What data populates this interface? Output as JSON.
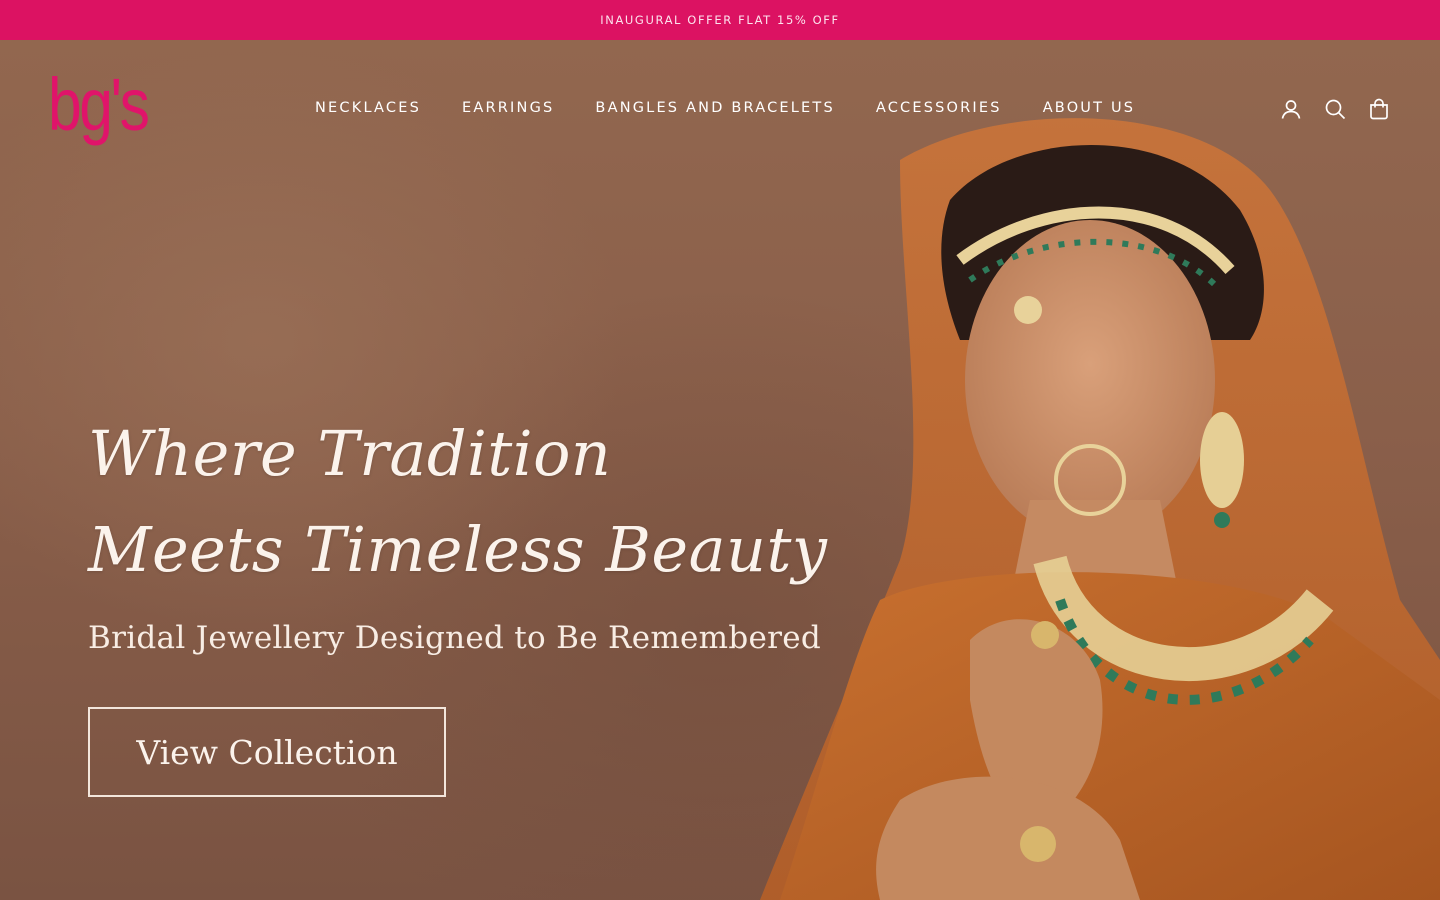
{
  "colors": {
    "announcement_bg": "#dc1262",
    "brand_pink": "#e0146a",
    "nav_text": "#ffffff",
    "hero_bg": "#8a5e48"
  },
  "announcement": {
    "text": "INAUGURAL OFFER FLAT 15% OFF"
  },
  "header": {
    "logo_text": "bg's",
    "nav": [
      {
        "label": "NECKLACES"
      },
      {
        "label": "EARRINGS"
      },
      {
        "label": "BANGLES AND BRACELETS"
      },
      {
        "label": "ACCESSORIES"
      },
      {
        "label": "ABOUT US"
      }
    ],
    "icons": [
      "account-icon",
      "search-icon",
      "cart-icon"
    ]
  },
  "hero": {
    "headline_line1": "Where Tradition",
    "headline_line2": "Meets Timeless Beauty",
    "subheadline": "Bridal Jewellery Designed to Be Remembered",
    "cta_label": "View Collection"
  }
}
